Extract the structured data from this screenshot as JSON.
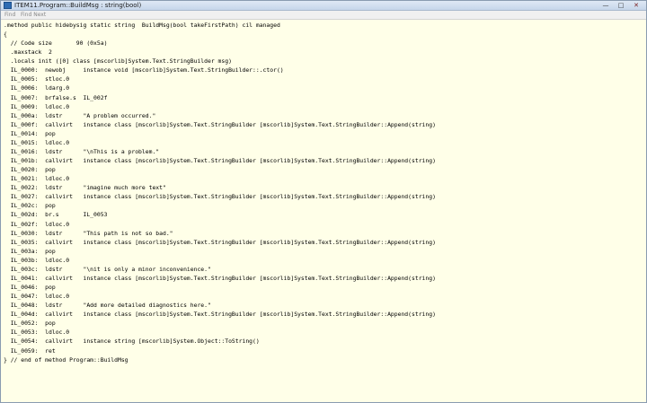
{
  "window": {
    "title": "ITEM11.Program::BuildMsg : string(bool)",
    "min_glyph": "—",
    "max_glyph": "□",
    "close_glyph": "✕"
  },
  "menu": {
    "find": "Find",
    "find_next": "Find Next"
  },
  "code": {
    "lines": [
      ".method public hidebysig static string  BuildMsg(bool takeFirstPath) cil managed",
      "{",
      "  // Code size       90 (0x5a)",
      "  .maxstack  2",
      "  .locals init ([0] class [mscorlib]System.Text.StringBuilder msg)",
      "  IL_0000:  newobj     instance void [mscorlib]System.Text.StringBuilder::.ctor()",
      "  IL_0005:  stloc.0",
      "  IL_0006:  ldarg.0",
      "  IL_0007:  brfalse.s  IL_002f",
      "  IL_0009:  ldloc.0",
      "  IL_000a:  ldstr      \"A problem occurred.\"",
      "  IL_000f:  callvirt   instance class [mscorlib]System.Text.StringBuilder [mscorlib]System.Text.StringBuilder::Append(string)",
      "  IL_0014:  pop",
      "  IL_0015:  ldloc.0",
      "  IL_0016:  ldstr      \"\\nThis is a problem.\"",
      "  IL_001b:  callvirt   instance class [mscorlib]System.Text.StringBuilder [mscorlib]System.Text.StringBuilder::Append(string)",
      "  IL_0020:  pop",
      "  IL_0021:  ldloc.0",
      "  IL_0022:  ldstr      \"imagine much more text\"",
      "  IL_0027:  callvirt   instance class [mscorlib]System.Text.StringBuilder [mscorlib]System.Text.StringBuilder::Append(string)",
      "  IL_002c:  pop",
      "  IL_002d:  br.s       IL_0053",
      "  IL_002f:  ldloc.0",
      "  IL_0030:  ldstr      \"This path is not so bad.\"",
      "  IL_0035:  callvirt   instance class [mscorlib]System.Text.StringBuilder [mscorlib]System.Text.StringBuilder::Append(string)",
      "  IL_003a:  pop",
      "  IL_003b:  ldloc.0",
      "  IL_003c:  ldstr      \"\\nit is only a minor inconvenience.\"",
      "  IL_0041:  callvirt   instance class [mscorlib]System.Text.StringBuilder [mscorlib]System.Text.StringBuilder::Append(string)",
      "  IL_0046:  pop",
      "  IL_0047:  ldloc.0",
      "  IL_0048:  ldstr      \"Add more detailed diagnostics here.\"",
      "  IL_004d:  callvirt   instance class [mscorlib]System.Text.StringBuilder [mscorlib]System.Text.StringBuilder::Append(string)",
      "  IL_0052:  pop",
      "  IL_0053:  ldloc.0",
      "  IL_0054:  callvirt   instance string [mscorlib]System.Object::ToString()",
      "  IL_0059:  ret",
      "} // end of method Program::BuildMsg"
    ]
  }
}
